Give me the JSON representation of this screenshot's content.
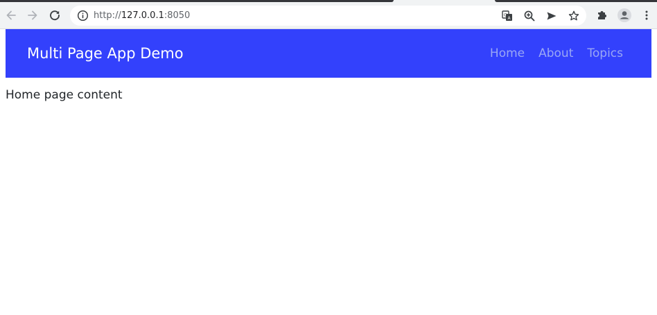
{
  "browser": {
    "url_scheme": "http://",
    "url_host": "127.0.0.1",
    "url_port": ":8050",
    "icons": {
      "back": "arrow-left-icon",
      "forward": "arrow-right-icon",
      "reload": "reload-icon",
      "site_info": "info-icon",
      "translate": "translate-icon",
      "zoom": "zoom-icon",
      "send": "send-icon",
      "bookmark": "star-icon",
      "extensions": "puzzle-icon",
      "profile": "profile-icon",
      "menu": "kebab-menu-icon"
    }
  },
  "app": {
    "brand": "Multi Page App Demo",
    "nav_links": [
      "Home",
      "About",
      "Topics"
    ],
    "content": "Home page content",
    "colors": {
      "navbar_bg": "#3341fc",
      "link_color": "#9aa7f5"
    }
  }
}
